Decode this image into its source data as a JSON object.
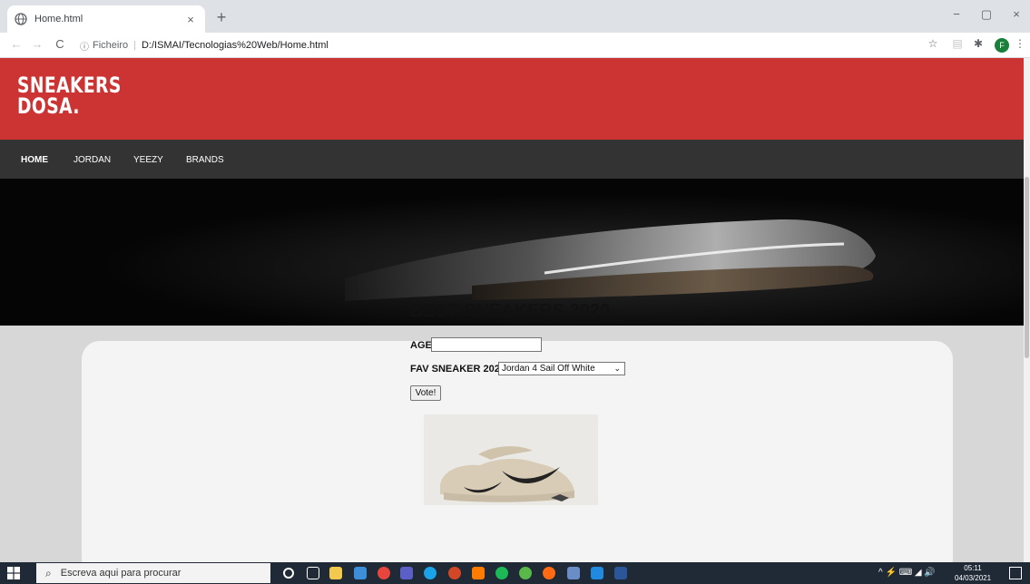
{
  "browser": {
    "tab_title": "Home.html",
    "tab_close": "×",
    "new_tab": "+",
    "window_controls": {
      "minimize": "−",
      "maximize": "▢",
      "close": "×"
    },
    "nav": {
      "back": "←",
      "forward": "→",
      "reload": "C"
    },
    "address": {
      "info_icon": "ⓘ",
      "prefix": "Ficheiro",
      "separator": "|",
      "url": "D:/ISMAI/Tecnologias%20Web/Home.html"
    },
    "toolbar_icons": {
      "star": "☆",
      "extension": "▤",
      "puzzle": "✱",
      "menu": "⋮"
    },
    "profile_initial": "F",
    "profile_color": "#188038"
  },
  "site": {
    "logo_line1": "SNEAKERS",
    "logo_line2": "DOSA.",
    "brand_color": "#cc3333",
    "nav_color": "#333333",
    "nav": [
      {
        "label": "HOME"
      },
      {
        "label": "JORDAN"
      },
      {
        "label": "YEEZY"
      },
      {
        "label": "BRANDS"
      }
    ],
    "form": {
      "heading": "BEST SNEAKERS 2020",
      "age_label": "AGE:",
      "age_value": "",
      "fav_label": "FAV SNEAKER 2020:",
      "fav_selected": "Jordan 4 Sail Off White",
      "vote_label": "Vote!"
    }
  },
  "taskbar": {
    "search_placeholder": "Escreva aqui para procurar",
    "tray_text": "^ ⚡ ⌨ ◢ 🔊",
    "time": "05:11",
    "date": "04/03/2021"
  }
}
